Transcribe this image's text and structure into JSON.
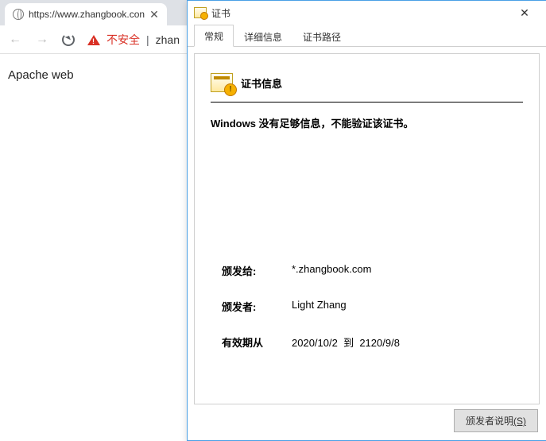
{
  "browser": {
    "tab_title": "https://www.zhangbook.con",
    "nav": {
      "back": "←",
      "forward": "→"
    },
    "insecure_label": "不安全",
    "url_visible": "zhan",
    "page_text": "Apache web"
  },
  "dialog": {
    "title": "证书",
    "close": "✕",
    "tabs": [
      "常规",
      "详细信息",
      "证书路径"
    ],
    "active_tab": 0,
    "section_title": "证书信息",
    "message_prefix": "Windows ",
    "message_rest": "没有足够信息，不能验证该证书。",
    "issued_to_label": "颁发给:",
    "issued_to_value": "*.zhangbook.com",
    "issuer_label": "颁发者:",
    "issuer_value": "Light Zhang",
    "valid_from_label": "有效期从",
    "valid_from": "2020/10/2",
    "valid_to_label": "到",
    "valid_to": "2120/9/8",
    "issuer_statement_btn": "颁发者说明",
    "issuer_statement_hotkey": "(S)"
  }
}
